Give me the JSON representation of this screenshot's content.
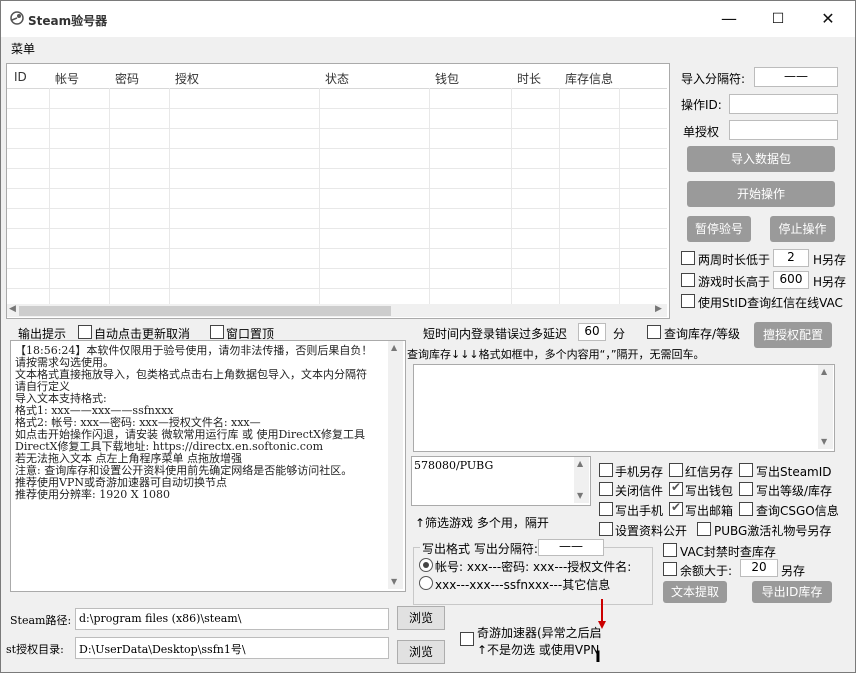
{
  "window": {
    "title": "Steam验号器",
    "min_label": "—",
    "max_label": "☐",
    "close_label": "✕"
  },
  "menu": {
    "main": "菜单"
  },
  "table": {
    "columns": [
      "ID",
      "帐号",
      "密码",
      "授权",
      "状态",
      "钱包",
      "时长",
      "库存信息"
    ]
  },
  "right": {
    "import_sep_label": "导入分隔符:",
    "import_sep_value": "——",
    "op_id_label": "操作ID:",
    "op_id_value": "",
    "single_auth_label": "单授权",
    "single_auth_value": "",
    "import_btn": "导入数据包",
    "start_btn": "开始操作",
    "pause_btn": "暂停验号",
    "stop_btn": "停止操作",
    "two_week_label": "两周时长低于",
    "two_week_value": "2",
    "two_week_unit": "H另存",
    "game_time_label": "游戏时长高于",
    "game_time_value": "600",
    "game_time_unit": "H另存",
    "stid_vac": "使用StID查询红信在线VAC"
  },
  "log": {
    "title": "输出提示",
    "auto_refresh": "自动点击更新取消",
    "window_top": "窗口置顶",
    "text": "【18:56:24】本软件仅限用于验号使用，请勿非法传播，否则后果自负！请按需求勾选使用。\n文本格式直接拖放导入，包类格式点击右上角数据包导入，文本内分隔符请自行定义\n导入文本支持格式:\n格式1: xxx——xxx——ssfnxxx\n格式2: 帐号: xxx—密码: xxx—授权文件名: xxx—\n如点击开始操作闪退，请安装 微软常用运行库 或 使用DirectX修复工具\nDirectX修复工具下载地址: https://directx.en.softonic.com\n若无法拖入文本 点左上角程序菜单 点拖放增强\n注意: 查询库存和设置公开资料使用前先确定网络是否能够访问社区。\n推荐使用VPN或奇游加速器可自动切换节点\n推荐使用分辨率: 1920 X 1080"
  },
  "middle": {
    "delay_label": "短时间内登录错误过多延迟",
    "delay_value": "60",
    "delay_unit": "分",
    "query_level": "查询库存/等级",
    "auth_config_btn": "擅授权配置",
    "inventory_hint": "查询库存↓↓↓格式如框中，多个内容用“，”隔开，无需回车。",
    "filter_value": "578080/PUBG",
    "filter_hint": "↑筛选游戏 多个用，隔开"
  },
  "options": {
    "phone_save": "手机另存",
    "red_save": "红信另存",
    "steamid_write": "写出SteamID",
    "close_mail": "关闭信件",
    "wallet_write": "写出钱包",
    "level_write": "写出等级/库存",
    "phone_write": "写出手机",
    "mail_write": "写出邮箱",
    "csgo_query": "查询CSGO信息",
    "public_profile": "设置资料公开",
    "pubg_save": "PUBG激活礼物号另存"
  },
  "write_format": {
    "title": "写出格式 写出分隔符:",
    "sep_value": "——",
    "opt1": "帐号: xxx---密码: xxx---授权文件名:",
    "opt2": "xxx---xxx---ssfnxxx---其它信息"
  },
  "vac": {
    "vac_save": "VAC封禁时查库存",
    "balance_label": "余额大于:",
    "balance_value": "20",
    "balance_unit": "另存",
    "text_extract_btn": "文本提取",
    "export_id_btn": "导出ID库存"
  },
  "paths": {
    "steam_label": "Steam路径:",
    "steam_value": "d:\\program files (x86)\\steam\\",
    "st_label": "st授权目录:",
    "st_value": "D:\\UserData\\Desktop\\ssfn1号\\",
    "browse": "浏览",
    "qiyou_label": "奇游加速器(异常之后启",
    "qiyou_hint": "↑不是勿选 或使用VPN"
  }
}
